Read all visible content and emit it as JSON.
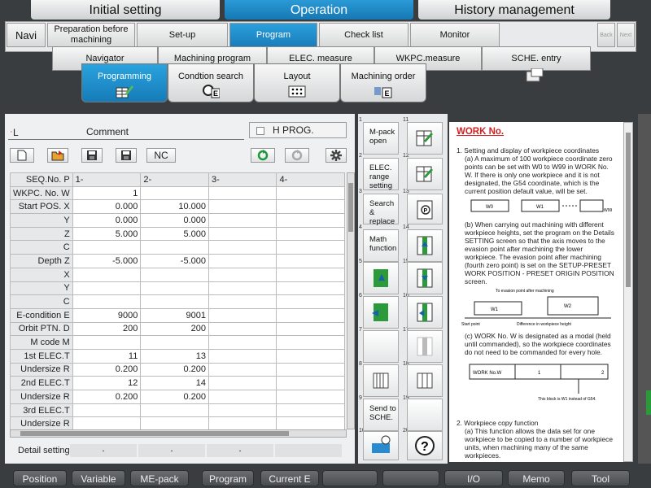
{
  "top_tabs": [
    "Initial setting",
    "Operation",
    "History management"
  ],
  "row2": {
    "navi": "Navi",
    "items": [
      "Preparation before machining",
      "Set-up",
      "Program",
      "Check list",
      "Monitor"
    ],
    "back": "Back",
    "next": "Next"
  },
  "row3": [
    "Navigator",
    "Machining program",
    "ELEC. measure",
    "WKPC.measure",
    "SCHE. entry"
  ],
  "row4": [
    "Programming",
    "Condtion search",
    "Layout",
    "Machining order"
  ],
  "file": {
    "label": "L",
    "prefix": "·",
    "comment": "Comment",
    "hprog": "H PROG.",
    "nc": "NC"
  },
  "table": {
    "header": [
      "SEQ.No. P",
      "1-",
      "2-",
      "3-",
      "4-"
    ],
    "rows": [
      [
        "WKPC. No. W",
        "1",
        "",
        ""
      ],
      [
        "Start POS. X",
        "0.000",
        "10.000",
        ""
      ],
      [
        "Y",
        "0.000",
        "0.000",
        ""
      ],
      [
        "Z",
        "5.000",
        "5.000",
        ""
      ],
      [
        "C",
        "",
        "",
        ""
      ],
      [
        "Depth  Z",
        "-5.000",
        "-5.000",
        ""
      ],
      [
        "X",
        "",
        "",
        ""
      ],
      [
        "Y",
        "",
        "",
        ""
      ],
      [
        "C",
        "",
        "",
        ""
      ],
      [
        "E-condition E",
        "9000",
        "9001",
        ""
      ],
      [
        "Orbit PTN. D",
        "200",
        "200",
        ""
      ],
      [
        "M code  M",
        "",
        "",
        ""
      ],
      [
        "1st ELEC.T",
        "11",
        "13",
        ""
      ],
      [
        "Undersize R",
        "0.200",
        "0.200",
        ""
      ],
      [
        "2nd ELEC.T",
        "12",
        "14",
        ""
      ],
      [
        "Undersize R",
        "0.200",
        "0.200",
        ""
      ],
      [
        "3rd ELEC.T",
        "",
        "",
        ""
      ],
      [
        "Undersize R",
        "",
        "",
        ""
      ]
    ],
    "detail": "Detail setting",
    "dash": "-"
  },
  "side": {
    "mpack": "M-pack open",
    "elec": "ELEC. range setting",
    "search": "Search & replace",
    "math": "Math function",
    "send": "Send to SCHE.",
    "nums": [
      "1",
      "2",
      "3",
      "4",
      "5",
      "6",
      "7",
      "8",
      "9",
      "10",
      "11",
      "12",
      "13",
      "14",
      "15",
      "16",
      "17",
      "18",
      "19",
      "20"
    ]
  },
  "doc": {
    "title": "WORK No.",
    "p1": "1.  Setting and display of workpiece coordinates",
    "p1a": "(a) A maximum of 100 workpiece coordinate zero points can be set with W0 to W99 in WORK No. W. If there is only one workpiece and it is not designated, the G54 coordinate, which is the current position default value, will be set.",
    "fig1": [
      "W0",
      "W1",
      "W99"
    ],
    "p1b": "(b) When carrying out machining with different workpiece heights, set the program on the Details SETTING screen so that the axis moves to the evasion point after machining the lower workpiece. The evasion point after machining (fourth zero point) is set on the SETUP-PRESET WORK POSITION - PRESET ORIGIN POSITION screen.",
    "fig2": [
      "To evasion point after machining",
      "W1",
      "W2",
      "Start point",
      "Difference in workpiece height"
    ],
    "p1c": "(c) WORK No. W is designated as a modal (held until commanded), so the workpiece coordinates do not need to be commanded for every hole.",
    "fig3": [
      "WORK No.W",
      "1",
      "",
      "2",
      "This block is W1 instead of G54."
    ],
    "p2": "2.  Workpiece copy function",
    "p2a": "(a) This function allows the data set for one workpiece to be copied to a number of workpiece units, when machining many of the same workpieces."
  },
  "bottom": [
    "Position",
    "Variable",
    "ME-pack",
    "Program",
    "Current  E",
    "",
    "",
    "I/O",
    "",
    "Memo",
    "Tool"
  ]
}
